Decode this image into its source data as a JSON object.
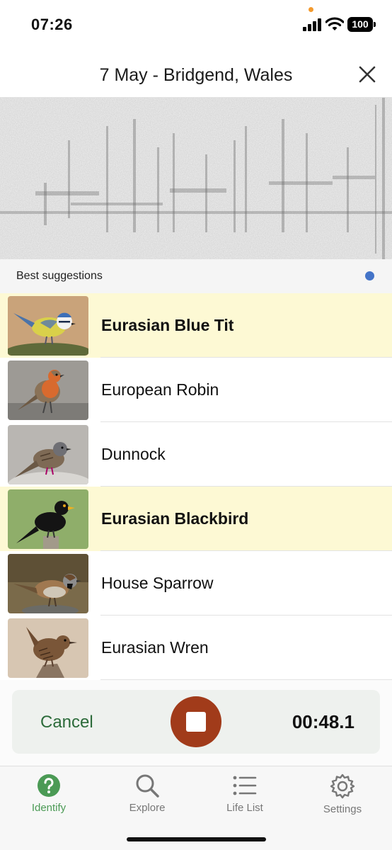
{
  "status_bar": {
    "time": "07:26",
    "battery": "100",
    "icons": [
      "signal-icon",
      "wifi-icon",
      "battery-icon"
    ]
  },
  "header": {
    "title": "7 May - Bridgend, Wales",
    "close_icon": "close-icon"
  },
  "suggestions": {
    "label": "Best suggestions",
    "indicator_color": "#4474c8",
    "highlight_color": "#fdf9d4",
    "birds": [
      {
        "name": "Eurasian Blue Tit",
        "highlighted": true
      },
      {
        "name": "European Robin",
        "highlighted": false
      },
      {
        "name": "Dunnock",
        "highlighted": false
      },
      {
        "name": "Eurasian Blackbird",
        "highlighted": true
      },
      {
        "name": "House Sparrow",
        "highlighted": false
      },
      {
        "name": "Eurasian Wren",
        "highlighted": false
      }
    ]
  },
  "recorder": {
    "cancel_label": "Cancel",
    "timer": "00:48.1",
    "stop_icon": "stop-icon",
    "stop_color": "#a13b1a"
  },
  "tabs": [
    {
      "label": "Identify",
      "icon": "question-circle-icon",
      "active": true
    },
    {
      "label": "Explore",
      "icon": "search-icon",
      "active": false
    },
    {
      "label": "Life List",
      "icon": "list-icon",
      "active": false
    },
    {
      "label": "Settings",
      "icon": "gear-icon",
      "active": false
    }
  ],
  "accent_color": "#4b9a55"
}
